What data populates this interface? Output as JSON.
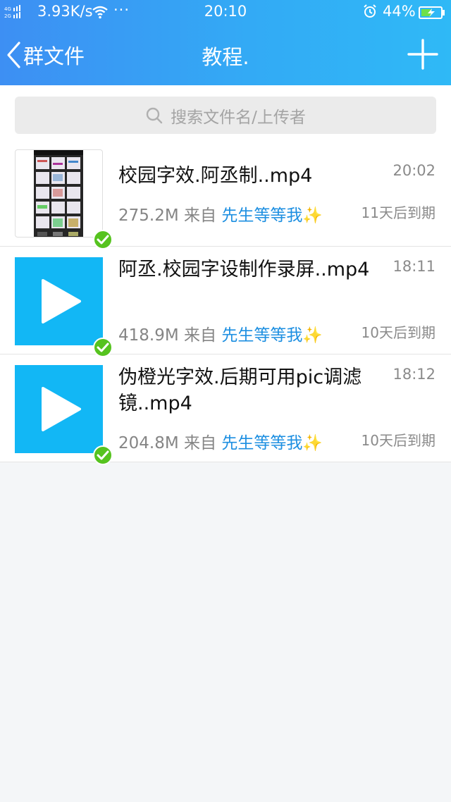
{
  "status_bar": {
    "network": "4G 2G",
    "speed": "3.93K/s",
    "more": "···",
    "time": "20:10",
    "battery": "44%"
  },
  "nav": {
    "back_label": "群文件",
    "title": "教程."
  },
  "search": {
    "placeholder": "搜索文件名/上传者"
  },
  "files": [
    {
      "name": "校园字效.阿丞制..mp4",
      "size": "275.2M",
      "from_label": "来自",
      "uploader": "先生等等我✨",
      "time": "20:02",
      "expire": "11天后到期",
      "thumb": "image"
    },
    {
      "name": "阿丞.校园字设制作录屏..mp4",
      "size": "418.9M",
      "from_label": "来自",
      "uploader": "先生等等我✨",
      "time": "18:11",
      "expire": "10天后到期",
      "thumb": "video"
    },
    {
      "name": "伪橙光字效.后期可用pic调滤镜..mp4",
      "size": "204.8M",
      "from_label": "来自",
      "uploader": "先生等等我✨",
      "time": "18:12",
      "expire": "10天后到期",
      "thumb": "video"
    }
  ],
  "colors": {
    "header_start": "#3d8ff3",
    "header_end": "#2fb9f6",
    "thumb_video": "#12b7f5",
    "uploader": "#1d8fe1",
    "check": "#56c31f"
  }
}
